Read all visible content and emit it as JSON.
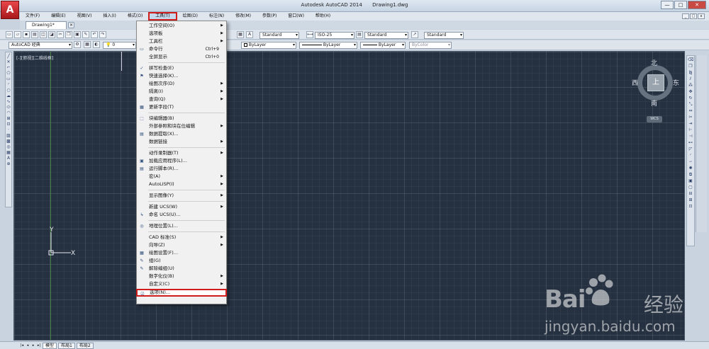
{
  "window": {
    "app_logo": "A",
    "title": "Autodesk AutoCAD 2014",
    "document_title": "Drawing1.dwg",
    "controls": [
      "—",
      "□",
      "✕"
    ]
  },
  "menubar": {
    "items": [
      "文件(F)",
      "编辑(E)",
      "视图(V)",
      "插入(I)",
      "格式(O)",
      "工具(T)",
      "绘图(D)",
      "标注(N)",
      "修改(M)",
      "参数(P)",
      "窗口(W)",
      "帮助(H)"
    ],
    "active_index": 5,
    "mdi_controls": [
      "_",
      "□",
      "x"
    ]
  },
  "tabs": {
    "document_tab": "Drawing1*",
    "close_glyph": "×"
  },
  "toolbar1": {
    "text_style": "Standard",
    "dim_style": "ISO-25",
    "table_style": "Standard",
    "multileader_style": "Standard"
  },
  "toolbar2": {
    "workspace": "AutoCAD 经典",
    "layer": "0",
    "color": "ByLayer",
    "linetype": "ByLayer",
    "lineweight": "ByLayer",
    "plotstyle": "ByColor"
  },
  "viewport": {
    "label": "[-][俯视][二维线框]",
    "ucs_x": "X",
    "ucs_y": "Y"
  },
  "viewcube": {
    "north": "北",
    "south": "南",
    "east": "东",
    "west": "西",
    "face": "上",
    "wcs": "WCS"
  },
  "tools_menu": {
    "items": [
      {
        "label": "工作空间(O)",
        "icon": "",
        "shortcut": "",
        "submenu": true
      },
      {
        "label": "选项板",
        "icon": "",
        "shortcut": "",
        "submenu": true
      },
      {
        "label": "工具栏",
        "icon": "",
        "shortcut": "",
        "submenu": true
      },
      {
        "label": "命令行",
        "icon": "▭",
        "shortcut": "Ctrl+9",
        "submenu": false
      },
      {
        "label": "全屏显示",
        "icon": "",
        "shortcut": "Ctrl+0",
        "submenu": false
      },
      {
        "sep": true
      },
      {
        "label": "拼写检查(E)",
        "icon": "✓",
        "shortcut": "",
        "submenu": false
      },
      {
        "label": "快速选择(K)...",
        "icon": "⚑",
        "shortcut": "",
        "submenu": false
      },
      {
        "label": "绘图次序(D)",
        "icon": "",
        "shortcut": "",
        "submenu": true
      },
      {
        "label": "隔离(I)",
        "icon": "",
        "shortcut": "",
        "submenu": true
      },
      {
        "label": "查询(Q)",
        "icon": "",
        "shortcut": "",
        "submenu": true
      },
      {
        "label": "更新字段(T)",
        "icon": "▦",
        "shortcut": "",
        "submenu": false
      },
      {
        "sep": true
      },
      {
        "label": "块编辑器(B)",
        "icon": "⬚",
        "shortcut": "",
        "submenu": false
      },
      {
        "label": "外部参照和块在位编辑",
        "icon": "",
        "shortcut": "",
        "submenu": true
      },
      {
        "label": "数据提取(X)...",
        "icon": "▤",
        "shortcut": "",
        "submenu": false
      },
      {
        "label": "数据链接",
        "icon": "",
        "shortcut": "",
        "submenu": true
      },
      {
        "sep": true
      },
      {
        "label": "动作录制器(T)",
        "icon": "",
        "shortcut": "",
        "submenu": true
      },
      {
        "label": "加载应用程序(L)...",
        "icon": "▣",
        "shortcut": "",
        "submenu": false
      },
      {
        "label": "运行脚本(R)...",
        "icon": "▤",
        "shortcut": "",
        "submenu": false
      },
      {
        "label": "宏(A)",
        "icon": "",
        "shortcut": "",
        "submenu": true
      },
      {
        "label": "AutoLISP(I)",
        "icon": "",
        "shortcut": "",
        "submenu": true
      },
      {
        "sep": true
      },
      {
        "label": "显示图像(Y)",
        "icon": "",
        "shortcut": "",
        "submenu": true
      },
      {
        "sep": true
      },
      {
        "label": "新建 UCS(W)",
        "icon": "",
        "shortcut": "",
        "submenu": true
      },
      {
        "label": "命名 UCS(U)...",
        "icon": "↳",
        "shortcut": "",
        "submenu": false
      },
      {
        "sep": true
      },
      {
        "label": "地理位置(L)...",
        "icon": "◎",
        "shortcut": "",
        "submenu": false
      },
      {
        "sep": true
      },
      {
        "label": "CAD 标准(S)",
        "icon": "",
        "shortcut": "",
        "submenu": true
      },
      {
        "label": "向导(Z)",
        "icon": "",
        "shortcut": "",
        "submenu": true
      },
      {
        "label": "绘图设置(F)...",
        "icon": "▦",
        "shortcut": "",
        "submenu": false
      },
      {
        "label": "组(G)",
        "icon": "✎",
        "shortcut": "",
        "submenu": false
      },
      {
        "label": "解除编组(U)",
        "icon": "✎",
        "shortcut": "",
        "submenu": false
      },
      {
        "label": "数字化仪(B)",
        "icon": "",
        "shortcut": "",
        "submenu": true
      },
      {
        "label": "自定义(C)",
        "icon": "",
        "shortcut": "",
        "submenu": true
      },
      {
        "label": "选项(N)...",
        "icon": "☑",
        "shortcut": "",
        "submenu": false,
        "highlight": true
      }
    ]
  },
  "layout_tabs": {
    "nav": [
      "|◂",
      "◂",
      "▸",
      "▸|"
    ],
    "tabs": [
      "模型",
      "布局1",
      "布局2"
    ]
  },
  "watermark": {
    "brand_latin": "Bai",
    "brand_cn": "经验",
    "url": "jingyan.baidu.com"
  }
}
